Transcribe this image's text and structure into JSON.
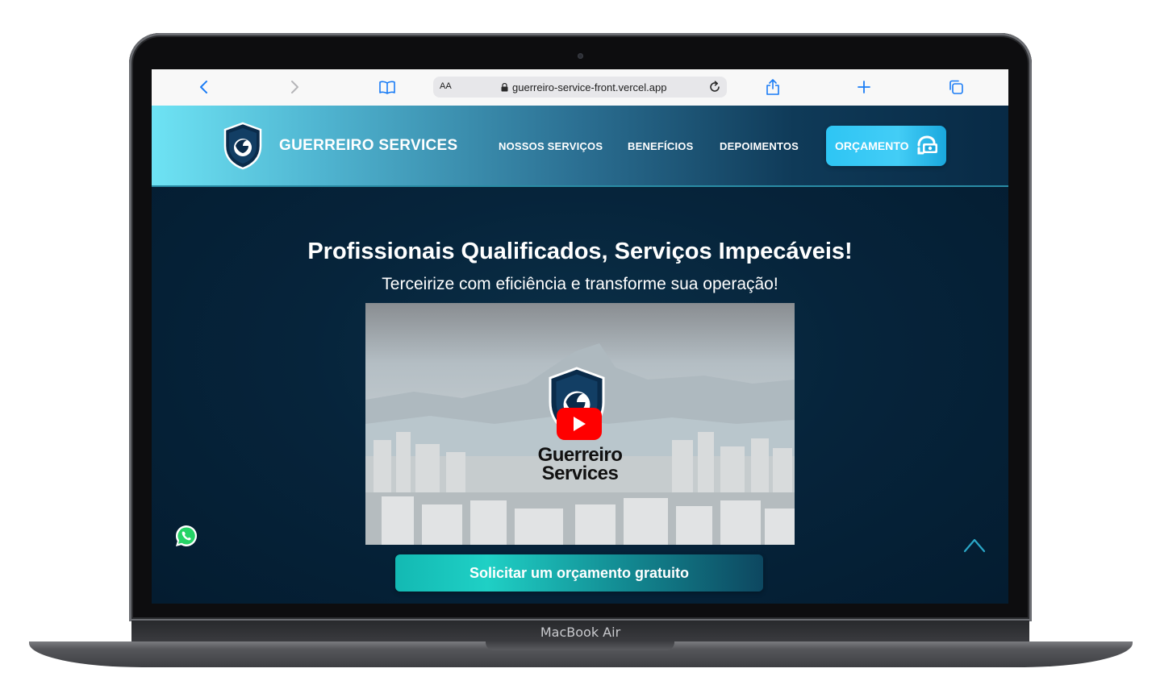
{
  "device": {
    "label": "MacBook Air"
  },
  "browser": {
    "text_size_label": "AA",
    "url": "guerreiro-service-front.vercel.app"
  },
  "site": {
    "brand": "GUERREIRO SERVICES",
    "nav": [
      {
        "label": "NOSSOS SERVIÇOS"
      },
      {
        "label": "BENEFÍCIOS"
      },
      {
        "label": "DEPOIMENTOS"
      }
    ],
    "cta_header": "ORÇAMENTO",
    "hero": {
      "title": "Profissionais Qualificados, Serviços Impecáveis!",
      "subtitle": "Terceirize com eficiência e transforme sua operação!",
      "video_logo_line1": "Guerreiro",
      "video_logo_line2": "Services",
      "cta": "Solicitar um orçamento gratuito"
    }
  },
  "colors": {
    "accent": "#2ec5f4",
    "hero_bg": "#041e33",
    "cta_teal": "#1fd0c5"
  }
}
